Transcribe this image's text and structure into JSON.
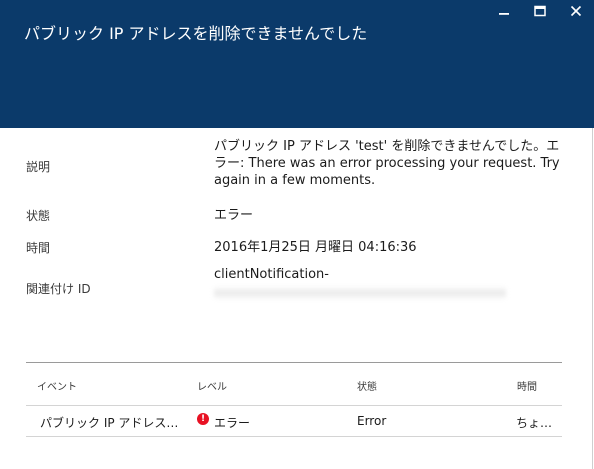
{
  "window": {
    "title": "パブリック IP アドレスを削除できませんでした",
    "controls": [
      {
        "name": "minimize-icon",
        "glyph": "minimize"
      },
      {
        "name": "maximize-icon",
        "glyph": "maximize"
      },
      {
        "name": "close-icon",
        "glyph": "close"
      }
    ]
  },
  "details": {
    "description_label": "説明",
    "description_value": "パブリック IP アドレス 'test' を削除できませんでした。エラー: There was an error processing your request. Try again in a few moments.",
    "status_label": "状態",
    "status_value": "エラー",
    "time_label": "時間",
    "time_value": "2016年1月25日 月曜日 04:16:36",
    "correlation_label": "関連付け ID",
    "correlation_value": "clientNotification-"
  },
  "events_table": {
    "headers": [
      "イベント",
      "レベル",
      "状態",
      "時間"
    ],
    "rows": [
      {
        "event": "パブリック IP アドレス…",
        "level": "エラー",
        "status": "Error",
        "time": "ちょ…"
      }
    ]
  },
  "colors": {
    "header_bg": "#0b3a6a",
    "error_red": "#e81123"
  }
}
